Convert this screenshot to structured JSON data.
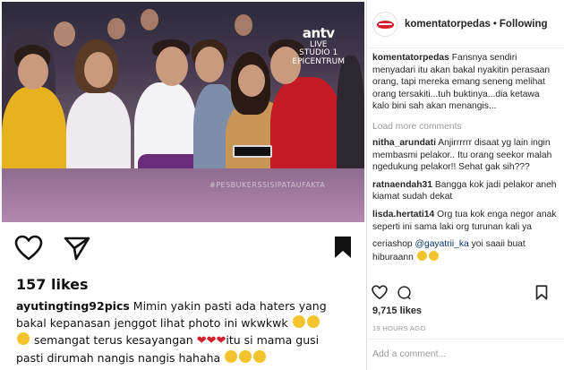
{
  "post_image": {
    "tv_channel_logo": "antv",
    "tv_logo_sub": "LIVE\nSTUDIO 1\nEPICENTRUM",
    "hashtag_overlay": "#PESBUKERSSISIPATAUFAKTA"
  },
  "repost": {
    "likes": "157 likes",
    "caption_user": "ayutingting92pics",
    "caption_text": "Mimin yakin pasti ada haters yang bakal kepanasan jenggot lihat photo ini wkwkwk",
    "caption_text_2": "semangat terus kesayangan",
    "caption_text_3": "itu si mama gusi pasti dirumah nangis nangis hahaha"
  },
  "header": {
    "username": "komentatorpedas",
    "separator": "•",
    "follow_status": "Following"
  },
  "comments": {
    "main": {
      "user": "komentatorpedas",
      "text": "Fansnya sendiri menyadari itu akan bakal nyakitin perasaan orang, tapi mereka emang seneng melihat orang tersakiti...tuh buktinya...dia ketawa kalo bini sah akan menangis..."
    },
    "load_more": "Load more comments",
    "items": [
      {
        "user": "nitha_arundati",
        "text": "Anjirrrrrr disaat yg lain ingin membasmi pelakor.. Itu orang seekor malah ngedukung pelakor!! Sehat gak sih???"
      },
      {
        "user": "ratnaendah31",
        "text": "Bangga kok jadi pelakor aneh kiamat sudah dekat"
      },
      {
        "user": "lisda.hertati14",
        "text": "Org tua kok enga negor anak seperti ini sama laki org turunan kali ya"
      },
      {
        "user": "ceriashop",
        "mention": "@gayatrii_ka",
        "text": "yoi saaii buat hiburaann"
      }
    ]
  },
  "panel_footer": {
    "likes": "9,715 likes",
    "time": "19 HOURS AGO",
    "add_comment_placeholder": "Add a comment..."
  },
  "icons": {
    "like": "heart-outline-icon",
    "comment": "comment-bubble-icon",
    "share": "paper-plane-icon",
    "save": "bookmark-icon"
  },
  "colors": {
    "accent_red": "#d3202c",
    "muted_text": "#999999",
    "border": "#dbdbdb"
  }
}
